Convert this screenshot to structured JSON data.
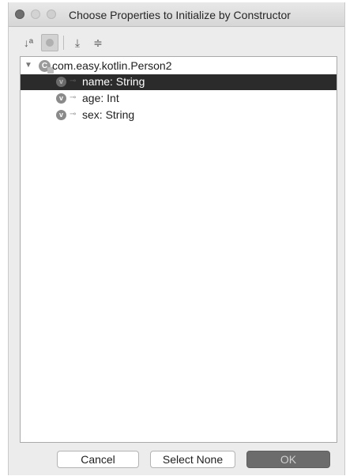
{
  "window": {
    "title": "Choose Properties to Initialize by Constructor"
  },
  "toolbar": {
    "icons": [
      "sort-alphabetically-icon",
      "show-inherited-icon",
      "expand-all-icon",
      "collapse-all-icon"
    ],
    "sort_glyph": "↓ª",
    "expand_glyph": "⤓",
    "collapse_glyph": "≑"
  },
  "tree": {
    "root": {
      "label": "com.easy.kotlin.Person2",
      "icon_letter": "C"
    },
    "items": [
      {
        "icon_letter": "v",
        "label": "name: String",
        "selected": true
      },
      {
        "icon_letter": "v",
        "label": "age: Int",
        "selected": false
      },
      {
        "icon_letter": "v",
        "label": "sex: String",
        "selected": false
      }
    ]
  },
  "buttons": {
    "cancel": "Cancel",
    "select_none": "Select None",
    "ok": "OK"
  },
  "colors": {
    "selection": "#2b2b2b",
    "ok_button": "#6c6c6c"
  }
}
